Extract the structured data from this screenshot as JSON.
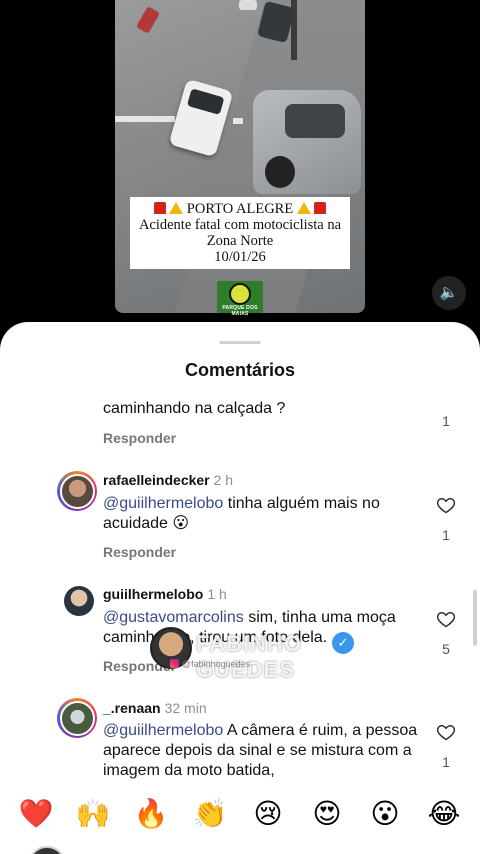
{
  "video": {
    "caption_line1": "PORTO ALEGRE",
    "caption_line2": "Acidente fatal com motociclista na",
    "caption_line3": "Zona Norte",
    "caption_line4": "10/01/26",
    "channel_logo_text": "PARQUE DOS MAIAS",
    "mute_icon": "speaker-icon"
  },
  "sheet": {
    "title": "Comentários"
  },
  "comments": [
    {
      "text": "caminhando na calçada ?",
      "reply_label": "Responder",
      "likes": "1"
    },
    {
      "username": "rafaelleindecker",
      "time": "2 h",
      "mention": "@guiilhermelobo",
      "text": " tinha alguém mais no acuidade 😮",
      "reply_label": "Responder",
      "likes": "1"
    },
    {
      "username": "guiilhermelobo",
      "time": "1 h",
      "mention": "@gustavomarcolins",
      "text": " sim, tinha uma moça caminhando, tirou um foto dela.",
      "reply_label": "Responder",
      "likes": "5"
    },
    {
      "username": "_.renaan",
      "time": "32 min",
      "mention": "@guiilhermelobo",
      "text": " A câmera é ruim, a pessoa aparece depois da sinal e se mistura com a imagem da moto batida,",
      "likes": "1"
    }
  ],
  "watermark": {
    "name": "FABINHO GUEDES",
    "handle": "@fabinhoguedes"
  },
  "reactions": [
    "❤️",
    "🙌",
    "🔥",
    "👏",
    "😢",
    "😍",
    "😮",
    "😂"
  ],
  "colors": {
    "mention": "#3b4a8f",
    "background": "#ffffff",
    "verified": "#3a97f0"
  }
}
